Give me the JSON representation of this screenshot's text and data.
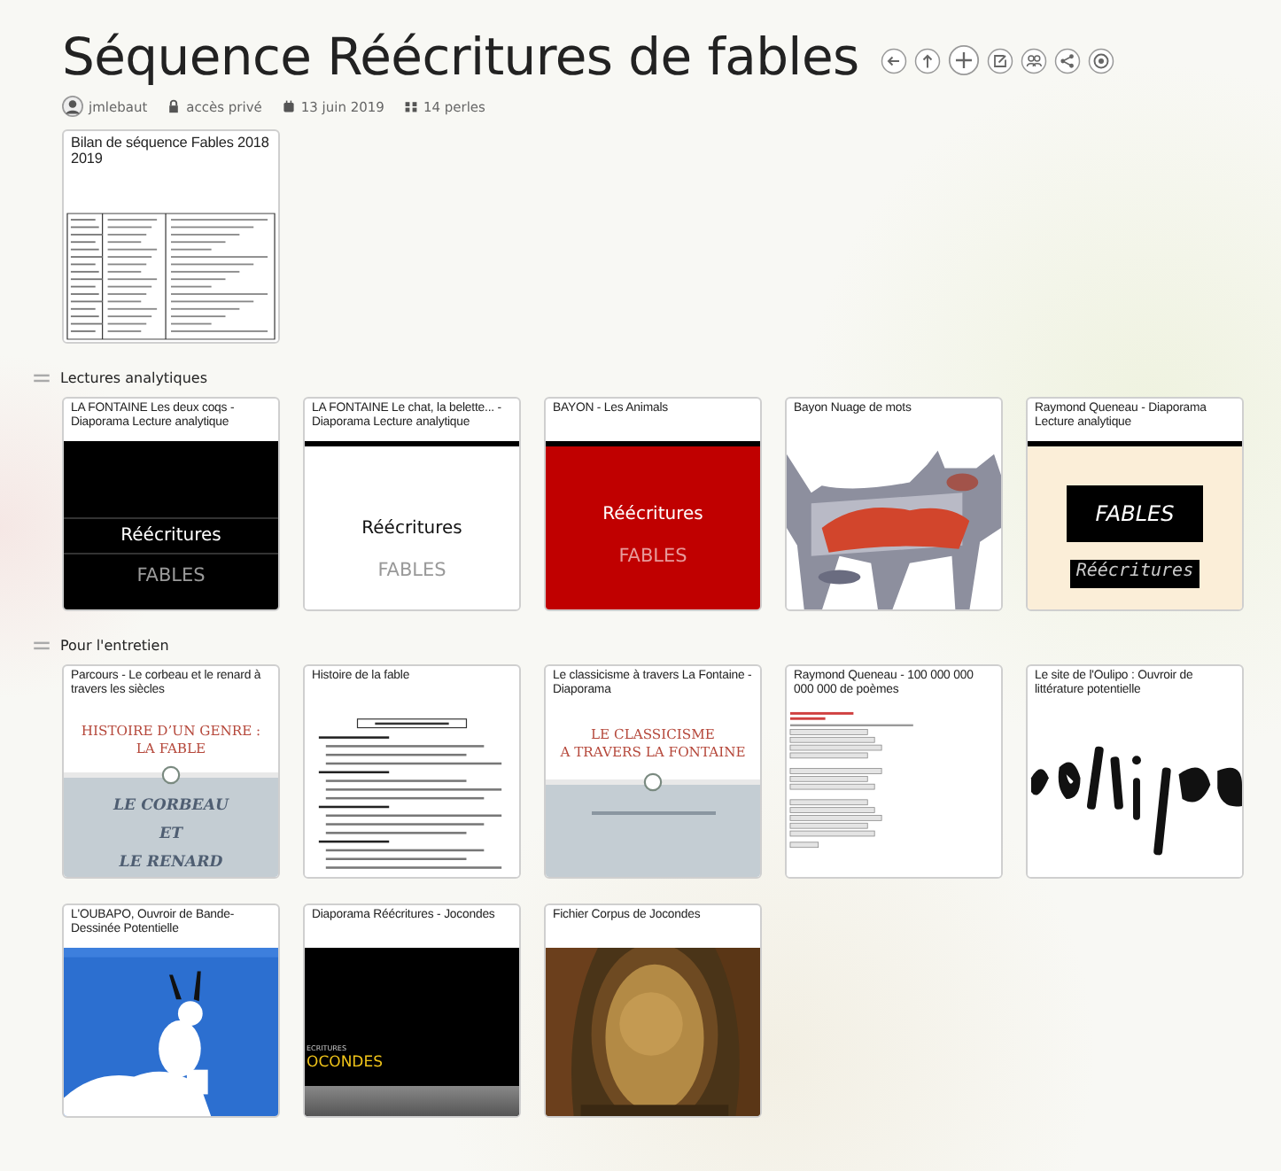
{
  "title": "Séquence Réécritures de fables",
  "meta": {
    "author": "jmlebaut",
    "access": "accès privé",
    "date": "13 juin 2019",
    "count": "14 perles"
  },
  "top_cards": [
    {
      "title": "Bilan de séquence Fables 2018 2019",
      "preview": {
        "kind": "document"
      }
    }
  ],
  "sections": [
    {
      "title": "Lectures analytiques",
      "expanded": true,
      "cards": [
        {
          "title": "LA FONTAINE Les deux coqs - Diaporama Lecture analytique",
          "preview": {
            "kind": "dark-slide",
            "title": "Réécritures",
            "subtitle": "FABLES"
          }
        },
        {
          "title": "LA FONTAINE Le chat, la belette... - Diaporama Lecture analytique",
          "preview": {
            "kind": "light-slide",
            "title": "Réécritures",
            "subtitle": "FABLES"
          }
        },
        {
          "title": "BAYON - Les Animals",
          "preview": {
            "kind": "red-slide",
            "title": "Réécritures",
            "subtitle": "FABLES"
          }
        },
        {
          "title": "Bayon Nuage de mots"
        },
        {
          "title": "Raymond Queneau - Diaporama Lecture analytique",
          "preview": {
            "kind": "box-slide",
            "title": "FABLES",
            "subtitle": "Réécritures"
          }
        }
      ]
    },
    {
      "title": "Pour l'entretien",
      "expanded": true,
      "cards": [
        {
          "title": "Parcours - Le corbeau et le renard à travers les siècles",
          "preview": {
            "kind": "split-slide",
            "top": [
              "HISTOIRE D’UN GENRE :",
              "LA FABLE"
            ],
            "bottom": [
              "LE CORBEAU",
              "ET",
              "LE RENARD"
            ]
          }
        },
        {
          "title": "Histoire de la fable",
          "preview": {
            "kind": "document"
          }
        },
        {
          "title": "Le classicisme à travers La Fontaine - Diaporama",
          "preview": {
            "kind": "split-slide",
            "top": [
              "LE CLASSICISME",
              "A TRAVERS LA FONTAINE"
            ]
          }
        },
        {
          "title": "Raymond Queneau - 100 000 000 000 000 de poèmes",
          "preview": {
            "kind": "form"
          }
        },
        {
          "title": "Le site de l'Oulipo : Ouvroir de littérature potentielle"
        },
        {
          "title": "L'OUBAPO, Ouvroir de Bande-Dessinée Potentielle"
        },
        {
          "title": "Diaporama Réécritures - Jocondes",
          "preview": {
            "kind": "banner-slide",
            "small": "ECRITURES",
            "big": "OCONDES"
          }
        },
        {
          "title": "Fichier Corpus de Jocondes"
        }
      ]
    }
  ]
}
